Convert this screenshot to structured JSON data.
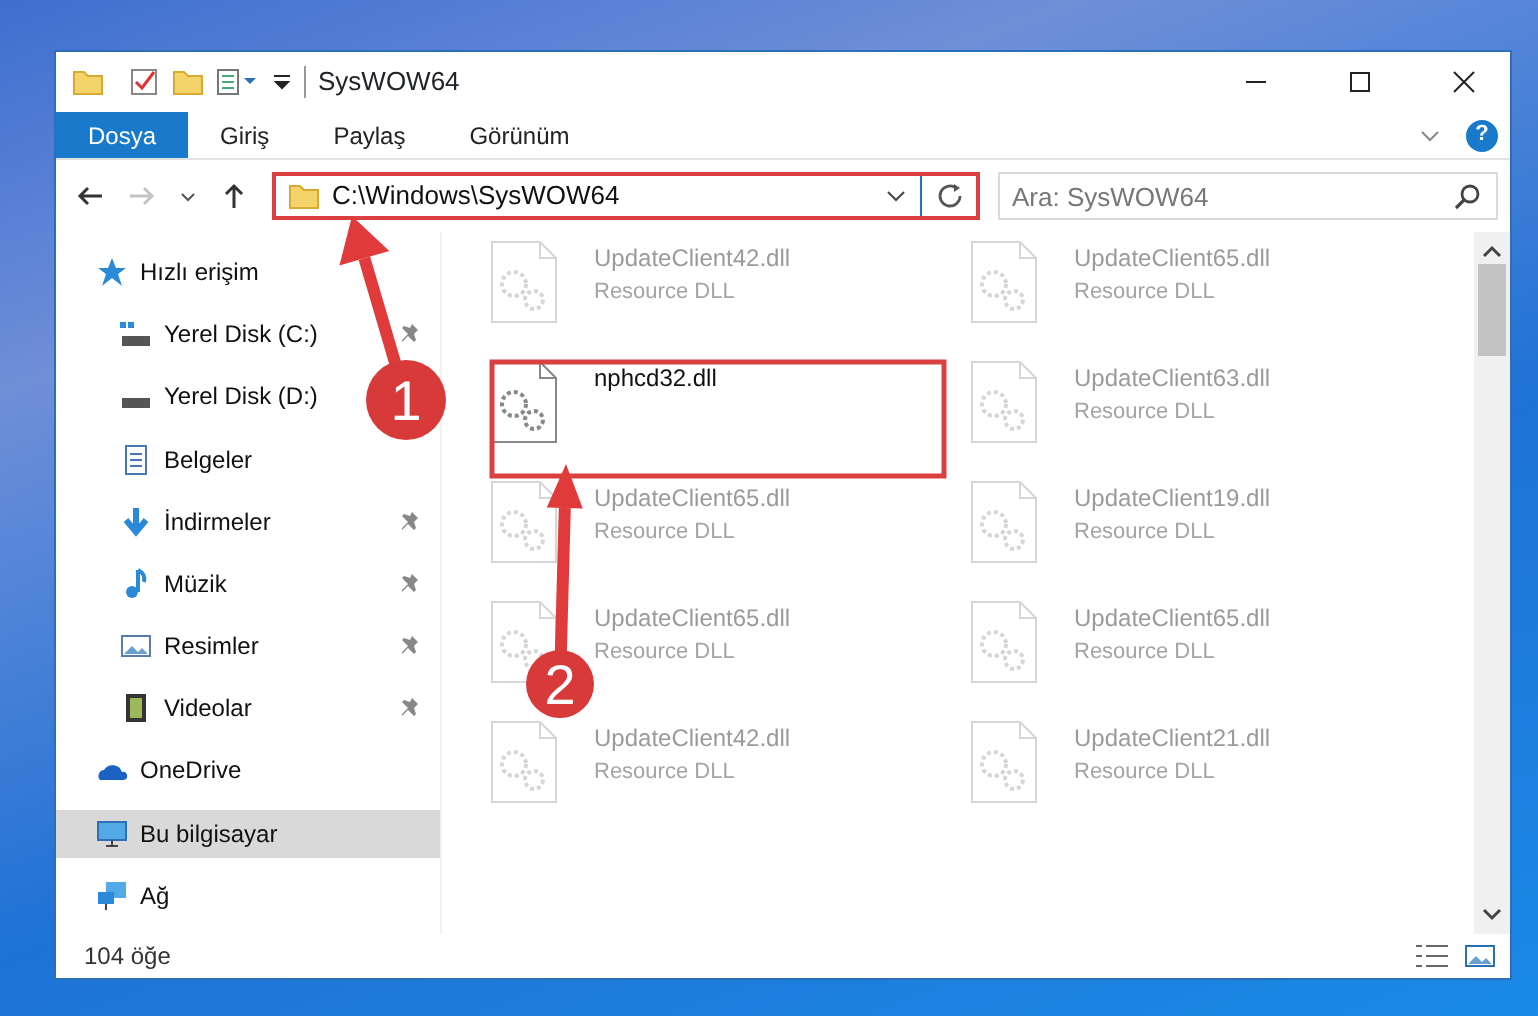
{
  "window": {
    "title": "SysWOW64"
  },
  "ribbon": {
    "tabs": [
      {
        "label": "Dosya",
        "selected": true
      },
      {
        "label": "Giriş",
        "selected": false
      },
      {
        "label": "Paylaş",
        "selected": false
      },
      {
        "label": "Görünüm",
        "selected": false
      }
    ],
    "help": "?"
  },
  "address_bar": {
    "path": "C:\\Windows\\SysWOW64",
    "forward_disabled": true
  },
  "search": {
    "placeholder": "Ara: SysWOW64"
  },
  "sidebar": {
    "items": [
      {
        "label": "Hızlı erişim",
        "kind": "star",
        "pinned": false,
        "selected": false,
        "children": [
          {
            "label": "Yerel Disk (C:)",
            "kind": "drive-c",
            "pinned": true,
            "selected": false
          },
          {
            "label": "Yerel Disk (D:)",
            "kind": "drive",
            "pinned": false,
            "selected": false
          },
          {
            "label": "Belgeler",
            "kind": "document",
            "pinned": false,
            "selected": false
          },
          {
            "label": "İndirmeler",
            "kind": "download",
            "pinned": true,
            "selected": false
          },
          {
            "label": "Müzik",
            "kind": "music",
            "pinned": true,
            "selected": false
          },
          {
            "label": "Resimler",
            "kind": "pictures",
            "pinned": true,
            "selected": false
          },
          {
            "label": "Videolar",
            "kind": "video",
            "pinned": true,
            "selected": false
          }
        ]
      },
      {
        "label": "OneDrive",
        "kind": "cloud",
        "pinned": false,
        "selected": false
      },
      {
        "label": "Bu bilgisayar",
        "kind": "computer",
        "pinned": false,
        "selected": true
      },
      {
        "label": "Ağ",
        "kind": "network",
        "pinned": false,
        "selected": false
      }
    ]
  },
  "files": [
    {
      "name": "UpdateClient42.dll",
      "type": "Resource DLL",
      "faded": true
    },
    {
      "name": "UpdateClient65.dll",
      "type": "Resource DLL",
      "faded": true
    },
    {
      "name": "nphcd32.dll",
      "faded": false
    },
    {
      "name": "UpdateClient63.dll",
      "type": "Resource DLL",
      "faded": true
    },
    {
      "name": "UpdateClient65.dll",
      "type": "Resource DLL",
      "faded": true
    },
    {
      "name": "UpdateClient19.dll",
      "type": "Resource DLL",
      "faded": true
    },
    {
      "name": "UpdateClient65.dll",
      "type": "Resource DLL",
      "faded": true
    },
    {
      "name": "UpdateClient65.dll",
      "type": "Resource DLL",
      "faded": true
    },
    {
      "name": "UpdateClient42.dll",
      "type": "Resource DLL",
      "faded": true
    },
    {
      "name": "UpdateClient21.dll",
      "type": "Resource DLL",
      "faded": true
    }
  ],
  "status_bar": {
    "count": "104 öğe"
  },
  "annotations": [
    {
      "number": "1"
    },
    {
      "number": "2"
    }
  ]
}
